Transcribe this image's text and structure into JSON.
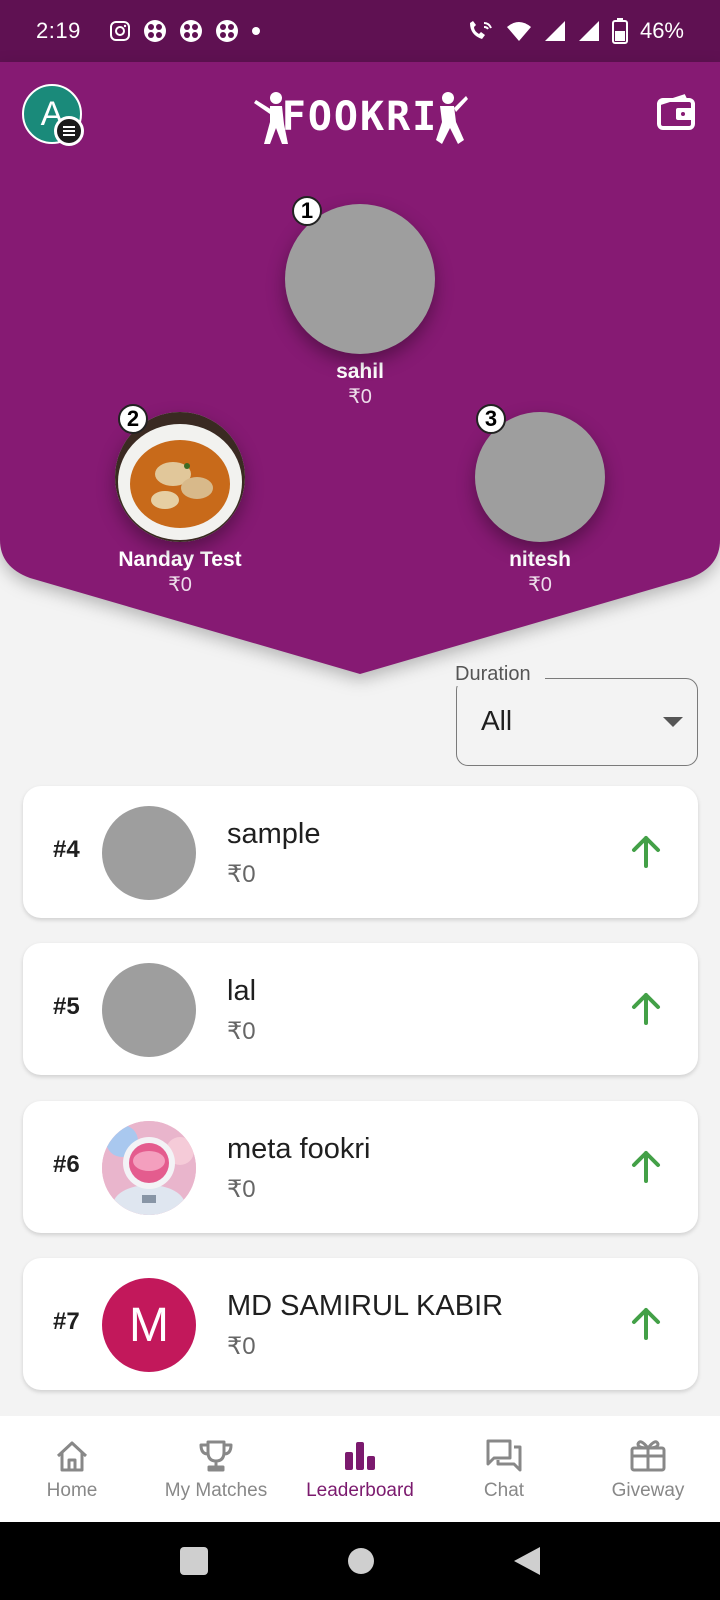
{
  "status_bar": {
    "time": "2:19",
    "battery": "46%",
    "left_icons": [
      "instagram-icon",
      "app-icon",
      "app-icon",
      "app-icon",
      "dot-icon"
    ],
    "right_icons": [
      "wifi-call-icon",
      "wifi-icon",
      "signal-icon",
      "signal-icon",
      "battery-icon"
    ]
  },
  "header": {
    "avatar_letter": "A",
    "logo_text": "FOOKRI",
    "brand_color": "#861a73"
  },
  "podium": [
    {
      "rank": "1",
      "name": "sahil",
      "amount": "₹0"
    },
    {
      "rank": "2",
      "name": "Nanday Test",
      "amount": "₹0"
    },
    {
      "rank": "3",
      "name": "nitesh",
      "amount": "₹0"
    }
  ],
  "filter": {
    "label": "Duration",
    "value": "All"
  },
  "leaderboard": [
    {
      "rank": "#4",
      "name": "sample",
      "amount": "₹0",
      "initial": ""
    },
    {
      "rank": "#5",
      "name": "lal",
      "amount": "₹0",
      "initial": ""
    },
    {
      "rank": "#6",
      "name": "meta fookri",
      "amount": "₹0",
      "initial": ""
    },
    {
      "rank": "#7",
      "name": "MD SAMIRUL KABIR",
      "amount": "₹0",
      "initial": "M"
    }
  ],
  "trend_color": "#43a047",
  "bottom_nav": [
    {
      "label": "Home",
      "icon": "home-icon"
    },
    {
      "label": "My Matches",
      "icon": "trophy-icon"
    },
    {
      "label": "Leaderboard",
      "icon": "bar-chart-icon",
      "active": true
    },
    {
      "label": "Chat",
      "icon": "chat-icon"
    },
    {
      "label": "Giveway",
      "icon": "gift-icon"
    }
  ]
}
